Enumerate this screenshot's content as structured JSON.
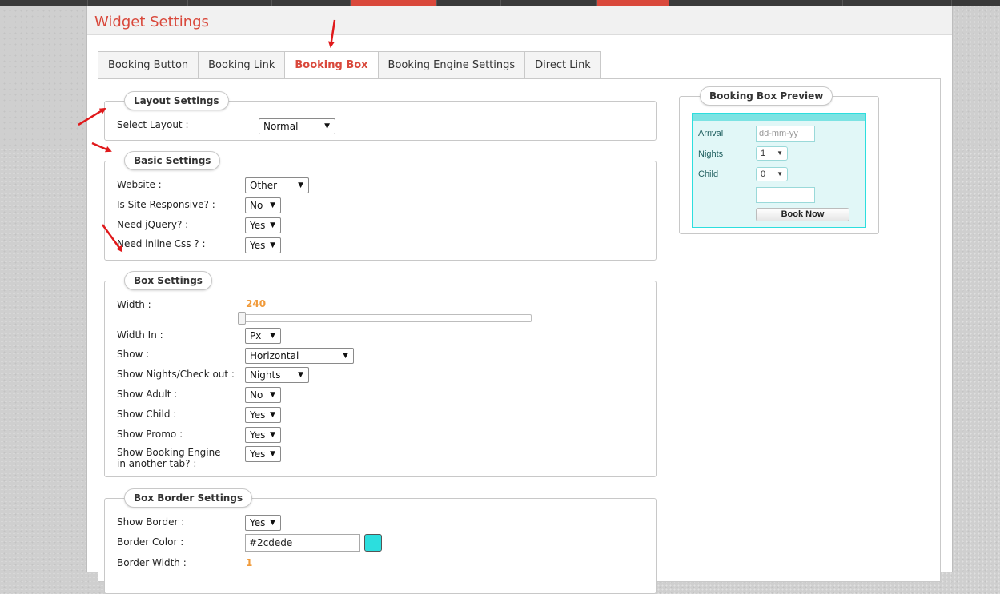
{
  "colors": {
    "accent": "#d9483b",
    "slider_value": "#f09a3a",
    "preview_border": "#2cdede"
  },
  "page": {
    "title": "Widget Settings"
  },
  "tabs": [
    {
      "label": "Booking Button"
    },
    {
      "label": "Booking Link"
    },
    {
      "label": "Booking Box"
    },
    {
      "label": "Booking Engine Settings"
    },
    {
      "label": "Direct Link"
    }
  ],
  "active_tab": "Booking Box",
  "layout_settings": {
    "legend": "Layout Settings",
    "select_layout": {
      "label": "Select Layout :",
      "value": "Normal"
    }
  },
  "basic_settings": {
    "legend": "Basic Settings",
    "website": {
      "label": "Website :",
      "value": "Other"
    },
    "responsive": {
      "label": "Is Site Responsive? :",
      "value": "No"
    },
    "jquery": {
      "label": "Need jQuery? :",
      "value": "Yes"
    },
    "inline_css": {
      "label": "Need inline Css ? :",
      "value": "Yes"
    }
  },
  "box_settings": {
    "legend": "Box Settings",
    "width": {
      "label": "Width :",
      "value": "240"
    },
    "width_in": {
      "label": "Width In :",
      "value": "Px"
    },
    "show": {
      "label": "Show :",
      "value": "Horizontal"
    },
    "show_nights": {
      "label": "Show Nights/Check out :",
      "value": "Nights"
    },
    "show_adult": {
      "label": "Show Adult :",
      "value": "No"
    },
    "show_child": {
      "label": "Show Child :",
      "value": "Yes"
    },
    "show_promo": {
      "label": "Show Promo :",
      "value": "Yes"
    },
    "show_engine_tab": {
      "label": "Show Booking Engine in another tab? :",
      "value": "Yes"
    }
  },
  "border_settings": {
    "legend": "Box Border Settings",
    "show_border": {
      "label": "Show Border :",
      "value": "Yes"
    },
    "border_color": {
      "label": "Border Color :",
      "value": "#2cdede"
    },
    "border_width": {
      "label": "Border Width :",
      "value": "1"
    }
  },
  "preview": {
    "legend": "Booking Box Preview",
    "bar_text": "...",
    "arrival_label": "Arrival",
    "arrival_placeholder": "dd-mm-yy",
    "nights_label": "Nights",
    "nights_value": "1",
    "child_label": "Child",
    "child_value": "0",
    "promo_value": "",
    "book_now": "Book Now"
  },
  "icons": {
    "dropdown": "triangle-down-icon",
    "annotation": "red-arrow-icon"
  }
}
